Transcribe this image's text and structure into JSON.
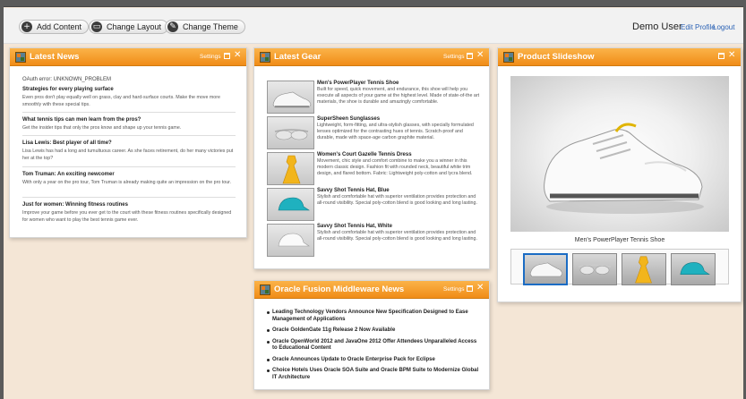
{
  "toolbar": {
    "add_content": "Add Content",
    "change_layout": "Change Layout",
    "change_theme": "Change Theme"
  },
  "user": {
    "name": "Demo User",
    "edit_profile": "Edit Profile",
    "logout": "Logout"
  },
  "panels": {
    "latest_news": {
      "title": "Latest News",
      "settings": "Settings",
      "error": "OAuth error: UNKNOWN_PROBLEM",
      "items": [
        {
          "title": "Strategies for every playing surface",
          "desc": "Even pros don't play equally well on grass, clay and hard-surface courts. Make the move more smoothly with these special tips."
        },
        {
          "title": "What tennis tips can men learn from the pros?",
          "desc": "Get the insider tips that only the pros know and shape up your tennis game."
        },
        {
          "title": "Lisa Lewis: Best player of all time?",
          "desc": "Lisa Lewis has had a long and tumultuous career. As she faces retirement, do her many victories put her at the top?"
        },
        {
          "title": "Tom Truman: An exciting newcomer",
          "desc": "With only a year on the pro tour, Tom Truman is already making quite an impression on the pro tour."
        },
        {
          "title": "Just for women: Winning fitness routines",
          "desc": "Improve your game before you ever get to the court with these fitness routines specifically designed for women who want to play the best tennis game ever."
        }
      ]
    },
    "latest_gear": {
      "title": "Latest Gear",
      "settings": "Settings",
      "items": [
        {
          "title": "Men's PowerPlayer Tennis Shoe",
          "desc": "Built for speed, quick movement, and endurance, this shoe will help you execute all aspects of your game at the highest level. Made of state-of-the art materials, the shoe is durable and amazingly comfortable.",
          "icon": "shoe-icon"
        },
        {
          "title": "SuperSheen Sunglasses",
          "desc": "Lightweight, form-fitting, and ultra-stylish glasses, with specially formulated lenses optimized for the contrasting hues of tennis. Scratch-proof and durable, made with space-age carbon graphite material.",
          "icon": "sunglasses-icon"
        },
        {
          "title": "Women's Court Gazelle Tennis Dress",
          "desc": "Movement, chic style and comfort combine to make you a winner in this modern classic design. Fashion fit with rounded neck, beautiful white trim design, and flared bottom. Fabric: Lightweight poly-cotton and lycra blend.",
          "icon": "dress-icon"
        },
        {
          "title": "Savvy Shot Tennis Hat, Blue",
          "desc": "Stylish and comfortable hat with superior ventilation provides protection and all-round visibility. Special poly-cotton blend is good looking and long lasting.",
          "icon": "hat-icon"
        },
        {
          "title": "Savvy Shot Tennis Hat, White",
          "desc": "Stylish and comfortable hat with superior ventilation provides protection and all-round visibility. Special poly-cotton blend is good looking and long lasting.",
          "icon": "hat-icon"
        }
      ]
    },
    "product_slideshow": {
      "title": "Product Slideshow",
      "caption": "Men's PowerPlayer Tennis Shoe",
      "selected_index": 0
    },
    "oracle_fusion": {
      "title": "Oracle Fusion Middleware News",
      "settings": "Settings",
      "items": [
        "Leading Technology Vendors Announce New Specification Designed to Ease Management of Applications",
        "Oracle GoldenGate 11g Release 2 Now Available",
        "Oracle OpenWorld 2012 and JavaOne 2012 Offer Attendees Unparalleled Access to Educational Content",
        "Oracle Announces Update to Oracle Enterprise Pack for Eclipse",
        "Choice Hotels Uses Oracle SOA Suite and Oracle BPM Suite to Modernize Global IT Architecture"
      ]
    }
  },
  "colors": {
    "panel_header": "#f08c17",
    "link": "#2b62b5",
    "background": "#f4e6d6"
  }
}
